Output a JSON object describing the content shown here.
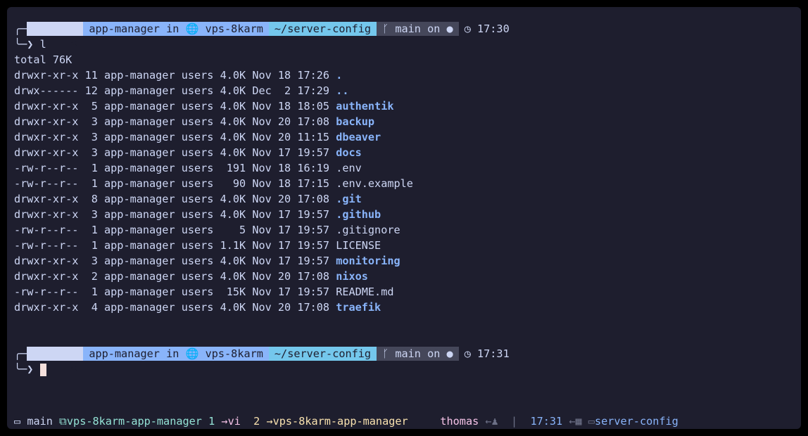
{
  "prompts": [
    {
      "os_icon": "gear-icon",
      "user": "app-manager",
      "in": "in",
      "host_icon": "globe-icon",
      "host": "vps-8karm",
      "path": "~/server-config",
      "branch_icon": "branch-icon",
      "branch": "main",
      "on": "on",
      "remote_icon": "github-icon",
      "time": "17:30",
      "command": "l"
    },
    {
      "os_icon": "gear-icon",
      "user": "app-manager",
      "in": "in",
      "host_icon": "globe-icon",
      "host": "vps-8karm",
      "path": "~/server-config",
      "branch_icon": "branch-icon",
      "branch": "main",
      "on": "on",
      "remote_icon": "github-icon",
      "time": "17:31",
      "command": ""
    }
  ],
  "listing": {
    "total": "total 76K",
    "rows": [
      {
        "perm": "drwxr-xr-x",
        "links": "11",
        "owner": "app-manager",
        "group": "users",
        "size": "4.0K",
        "date": "Nov 18 17:26",
        "name": ".",
        "is_dir": true
      },
      {
        "perm": "drwx------",
        "links": "12",
        "owner": "app-manager",
        "group": "users",
        "size": "4.0K",
        "date": "Dec  2 17:29",
        "name": "..",
        "is_dir": true
      },
      {
        "perm": "drwxr-xr-x",
        "links": " 5",
        "owner": "app-manager",
        "group": "users",
        "size": "4.0K",
        "date": "Nov 18 18:05",
        "name": "authentik",
        "is_dir": true
      },
      {
        "perm": "drwxr-xr-x",
        "links": " 3",
        "owner": "app-manager",
        "group": "users",
        "size": "4.0K",
        "date": "Nov 20 17:08",
        "name": "backup",
        "is_dir": true
      },
      {
        "perm": "drwxr-xr-x",
        "links": " 3",
        "owner": "app-manager",
        "group": "users",
        "size": "4.0K",
        "date": "Nov 20 11:15",
        "name": "dbeaver",
        "is_dir": true
      },
      {
        "perm": "drwxr-xr-x",
        "links": " 3",
        "owner": "app-manager",
        "group": "users",
        "size": "4.0K",
        "date": "Nov 17 19:57",
        "name": "docs",
        "is_dir": true
      },
      {
        "perm": "-rw-r--r--",
        "links": " 1",
        "owner": "app-manager",
        "group": "users",
        "size": " 191",
        "date": "Nov 18 16:19",
        "name": ".env",
        "is_dir": false
      },
      {
        "perm": "-rw-r--r--",
        "links": " 1",
        "owner": "app-manager",
        "group": "users",
        "size": "  90",
        "date": "Nov 18 17:15",
        "name": ".env.example",
        "is_dir": false
      },
      {
        "perm": "drwxr-xr-x",
        "links": " 8",
        "owner": "app-manager",
        "group": "users",
        "size": "4.0K",
        "date": "Nov 20 17:08",
        "name": ".git",
        "is_dir": true
      },
      {
        "perm": "drwxr-xr-x",
        "links": " 3",
        "owner": "app-manager",
        "group": "users",
        "size": "4.0K",
        "date": "Nov 17 19:57",
        "name": ".github",
        "is_dir": true
      },
      {
        "perm": "-rw-r--r--",
        "links": " 1",
        "owner": "app-manager",
        "group": "users",
        "size": "   5",
        "date": "Nov 17 19:57",
        "name": ".gitignore",
        "is_dir": false
      },
      {
        "perm": "-rw-r--r--",
        "links": " 1",
        "owner": "app-manager",
        "group": "users",
        "size": "1.1K",
        "date": "Nov 17 19:57",
        "name": "LICENSE",
        "is_dir": false
      },
      {
        "perm": "drwxr-xr-x",
        "links": " 3",
        "owner": "app-manager",
        "group": "users",
        "size": "4.0K",
        "date": "Nov 17 19:57",
        "name": "monitoring",
        "is_dir": true
      },
      {
        "perm": "drwxr-xr-x",
        "links": " 2",
        "owner": "app-manager",
        "group": "users",
        "size": "4.0K",
        "date": "Nov 20 17:08",
        "name": "nixos",
        "is_dir": true
      },
      {
        "perm": "-rw-r--r--",
        "links": " 1",
        "owner": "app-manager",
        "group": "users",
        "size": " 15K",
        "date": "Nov 17 19:57",
        "name": "README.md",
        "is_dir": false
      },
      {
        "perm": "drwxr-xr-x",
        "links": " 4",
        "owner": "app-manager",
        "group": "users",
        "size": "4.0K",
        "date": "Nov 20 17:08",
        "name": "traefik",
        "is_dir": true
      }
    ]
  },
  "statusbar": {
    "session_icon": "window-icon",
    "session": "main",
    "pane_icon": "pane-icon",
    "window1_name": "vps-8karm-app-manager",
    "window1_index": "1",
    "window2_arrow": "→",
    "window2_name": "vi",
    "window2_index": "2",
    "window3_arrow": "→",
    "window3_name": "vps-8karm-app-manager",
    "user": "thomas",
    "user_icon": "user-icon",
    "divider": "|",
    "time": "17:31",
    "calendar_icon": "calendar-icon",
    "folder_icon": "folder-icon",
    "folder": "server-config"
  },
  "colors": {
    "background": "#1e1e2e",
    "text": "#cdd6f4",
    "directory": "#89b4fa",
    "cursor": "#f5e0dc"
  }
}
